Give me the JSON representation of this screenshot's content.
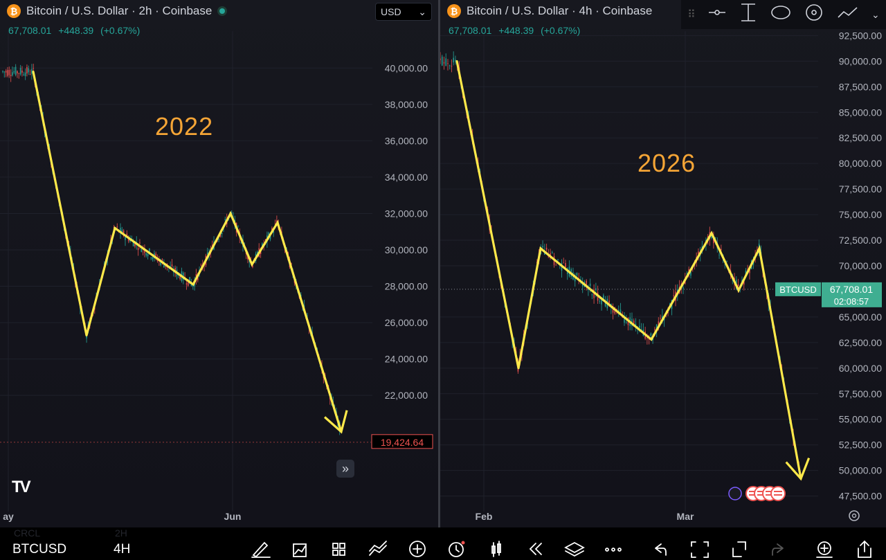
{
  "left": {
    "title": "Bitcoin / U.S. Dollar · 2h · Coinbase",
    "coin_glyph": "₿",
    "quote": {
      "price": "67,708.01",
      "change": "+448.39",
      "pct": "(+0.67%)"
    },
    "currency": "USD",
    "currency_arrow": "⌄",
    "year": "2022",
    "last_price_label": "19,424.64",
    "expand_glyph": "»",
    "logo": "TV"
  },
  "right": {
    "title": "Bitcoin / U.S. Dollar · 4h · Coinbase",
    "coin_glyph": "₿",
    "quote": {
      "price": "67,708.01",
      "change": "+448.39",
      "pct": "(+0.67%)"
    },
    "year": "2026",
    "symbol_tag": "BTCUSD",
    "price_tag": "67,708.01",
    "countdown": "02:08:57"
  },
  "bottom_bar": {
    "symbol": "BTCUSD",
    "interval": "4H",
    "ghost_symbol": "CRCL",
    "ghost_interval": "2H"
  },
  "colors": {
    "up": "#26a69a",
    "down": "#ef5350",
    "pattern": "#ffe94a",
    "year_label": "#f5a536",
    "price_tag": "#3fae91"
  },
  "chart_data": [
    {
      "type": "line",
      "title": "Bitcoin / U.S. Dollar · 2h · Coinbase",
      "year_annotation": "2022",
      "x_ticks": [
        "ay",
        "Jun"
      ],
      "y_ticks": [
        "40,000.00",
        "38,000.00",
        "36,000.00",
        "34,000.00",
        "32,000.00",
        "30,000.00",
        "28,000.00",
        "26,000.00",
        "24,000.00",
        "22,000.00"
      ],
      "ylim": [
        19000,
        41000
      ],
      "series": [
        {
          "values": [
            39800,
            25300,
            31200,
            28100,
            32000,
            29200,
            31500,
            20000
          ]
        }
      ],
      "last_price": 19424.64
    },
    {
      "type": "line",
      "title": "Bitcoin / U.S. Dollar · 4h · Coinbase",
      "year_annotation": "2026",
      "x_ticks": [
        "Feb",
        "Mar"
      ],
      "y_ticks": [
        "92,500.00",
        "90,000.00",
        "87,500.00",
        "85,000.00",
        "82,500.00",
        "80,000.00",
        "77,500.00",
        "75,000.00",
        "72,500.00",
        "70,000.00",
        "65,000.00",
        "62,500.00",
        "60,000.00",
        "57,500.00",
        "55,000.00",
        "52,500.00",
        "50,000.00",
        "47,500.00"
      ],
      "ylim": [
        47000,
        93000
      ],
      "series": [
        {
          "values": [
            90000,
            60000,
            71700,
            62800,
            73200,
            67600,
            71700,
            49200
          ]
        }
      ],
      "last_price": 67708.01
    }
  ]
}
